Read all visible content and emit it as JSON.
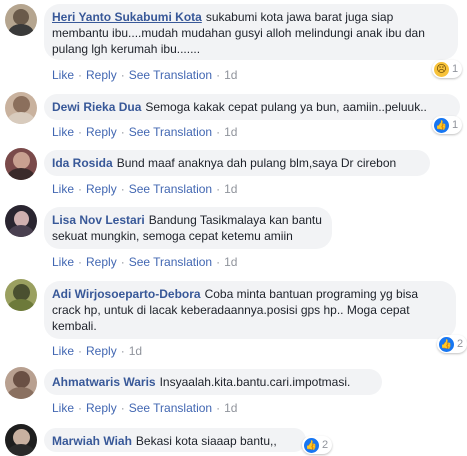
{
  "actions": {
    "like": "Like",
    "reply": "Reply",
    "see_translation": "See Translation",
    "sep": "·"
  },
  "comments": [
    {
      "author": "Heri Yanto Sukabumi Kota",
      "text": "sukabumi kota jawa barat juga siap membantu ibu....mudah mudahan gusyi alloh melindungi anak ibu dan pulang lgh kerumah ibu.......",
      "time": "1d",
      "reaction": {
        "icon": "sad-icon",
        "count": "1"
      },
      "avatar_color": "#7a6a5a"
    },
    {
      "author": "Dewi Rieka Dua",
      "text": "Semoga kakak cepat pulang ya bun, aamiin..peluuk..",
      "time": "1d",
      "reaction": {
        "icon": "like-icon",
        "count": "1"
      },
      "avatar_color": "#8b6f5c"
    },
    {
      "author": "Ida Rosida",
      "text": "Bund maaf anaknya dah pulang blm,saya Dr cirebon",
      "time": "1d",
      "reaction": null,
      "avatar_color": "#5b3b3b"
    },
    {
      "author": "Lisa Nov Lestari",
      "text": "Bandung Tasikmalaya kan bantu sekuat mungkin, semoga cepat ketemu amiin",
      "time": "1d",
      "reaction": null,
      "avatar_color": "#3a3440"
    },
    {
      "author": "Adi Wirjosoeparto-Debora",
      "text": "Coba minta bantuan programing yg bisa crack hp, untuk di lacak keberadaannya.posisi gps hp.. Moga cepat kembali.",
      "time": "1d",
      "reaction": {
        "icon": "like-icon",
        "count": "2"
      },
      "avatar_color": "#6d7a3a"
    },
    {
      "author": "Ahmatwaris Waris",
      "text": "Insyaalah.kita.bantu.cari.impotmasi.",
      "time": "1d",
      "reaction": null,
      "avatar_color": "#6a5044"
    },
    {
      "author": "Marwiah Wiah",
      "text": "Bekasi kota siaaap bantu,,",
      "time": "",
      "reaction": {
        "icon": "like-icon",
        "count": "2"
      },
      "avatar_color": "#2a2a2a"
    }
  ],
  "colors": {
    "link": "#385898",
    "meta": "#90949c",
    "bubble": "#f2f3f5"
  }
}
